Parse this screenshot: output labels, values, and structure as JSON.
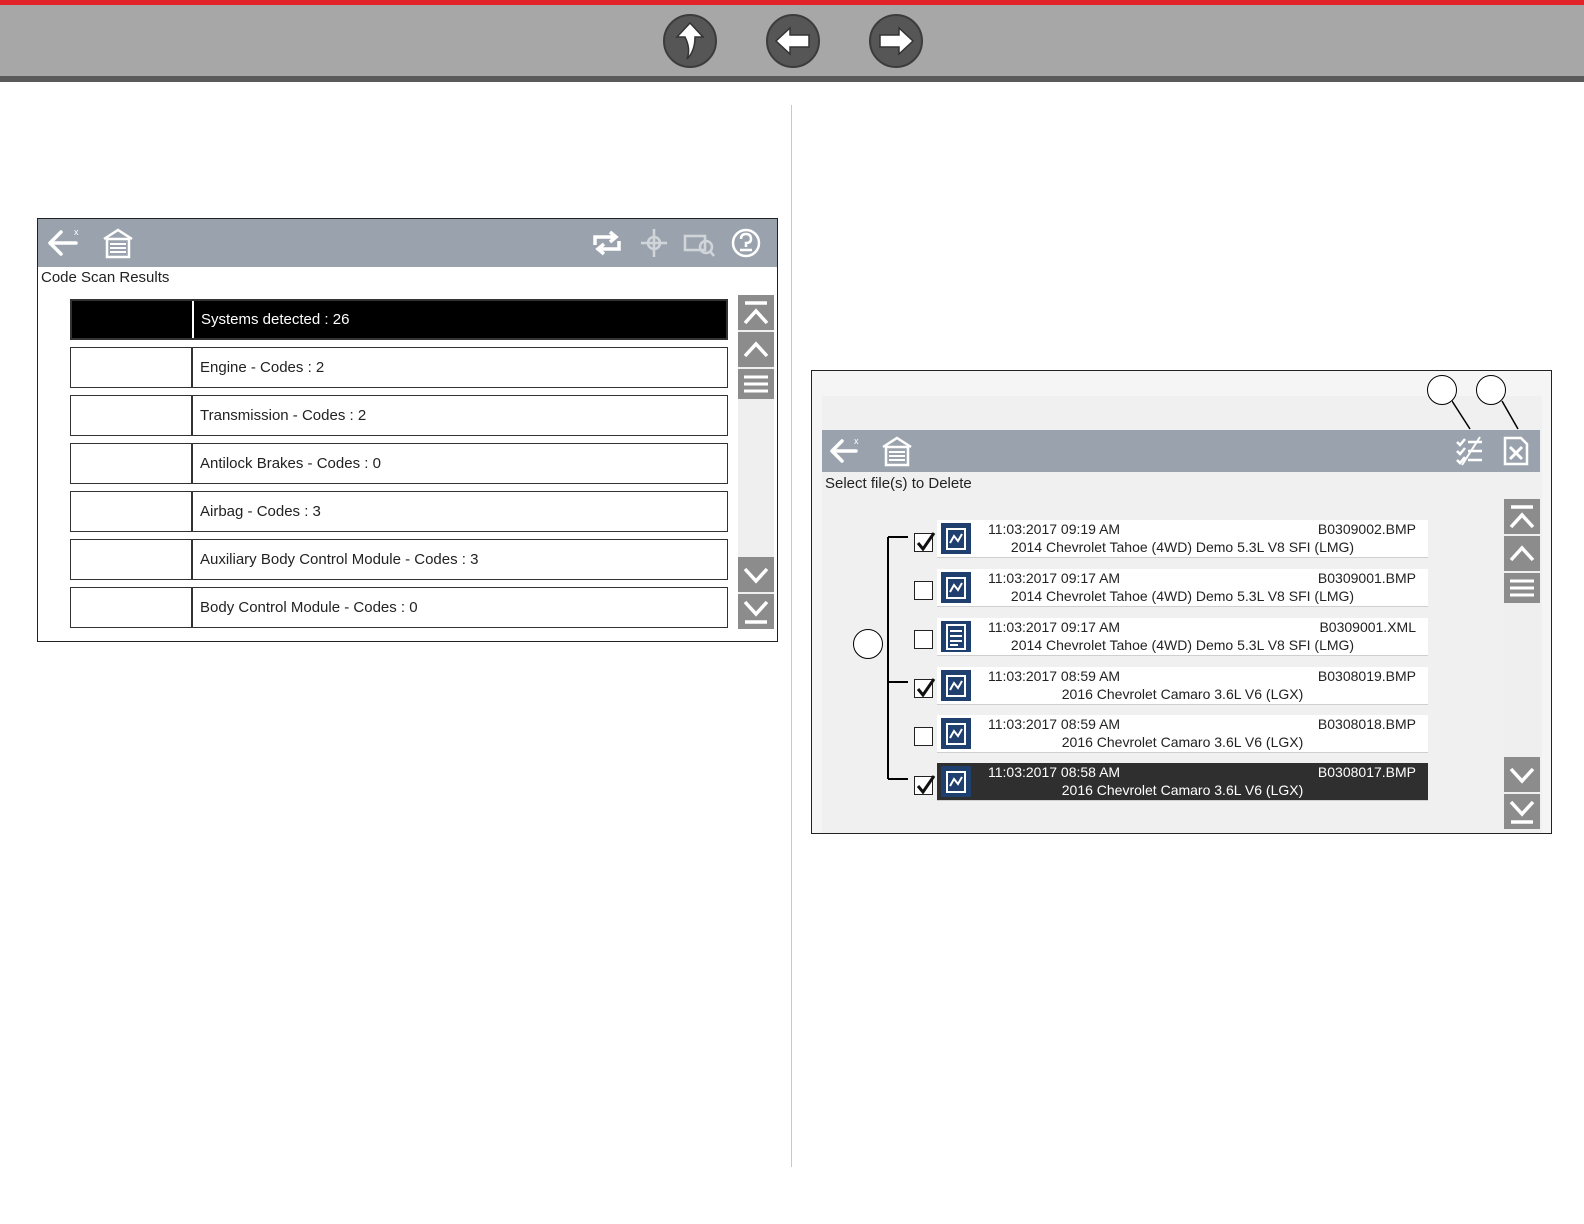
{
  "topnav": {
    "buttons": [
      {
        "name": "up-arrow-icon"
      },
      {
        "name": "back-arrow-icon"
      },
      {
        "name": "forward-arrow-icon"
      }
    ]
  },
  "screen1": {
    "title": "Code Scan Results",
    "toolbar_icons": [
      "back-icon",
      "home-icon",
      "refresh-icon",
      "vehicle-system-icon",
      "engine-search-icon",
      "help-icon"
    ],
    "rows": [
      {
        "label": "Systems detected : 26",
        "selected": true
      },
      {
        "label": "Engine - Codes : 2",
        "selected": false
      },
      {
        "label": "Transmission - Codes : 2",
        "selected": false
      },
      {
        "label": "Antilock Brakes - Codes : 0",
        "selected": false
      },
      {
        "label": "Airbag - Codes : 3",
        "selected": false
      },
      {
        "label": "Auxiliary Body Control Module - Codes : 3",
        "selected": false
      },
      {
        "label": "Body Control Module - Codes : 0",
        "selected": false
      }
    ]
  },
  "screen2": {
    "title": "Select file(s) to Delete",
    "toolbar_icons": [
      "back-icon",
      "home-icon",
      "select-all-icon",
      "delete-icon"
    ],
    "files": [
      {
        "date": "11:03:2017 09:19 AM",
        "file": "B0309002.BMP",
        "vehicle": "2014 Chevrolet Tahoe (4WD) Demo 5.3L V8 SFI (LMG)",
        "checked": true,
        "type": "image",
        "highlighted": false
      },
      {
        "date": "11:03:2017 09:17 AM",
        "file": "B0309001.BMP",
        "vehicle": "2014 Chevrolet Tahoe (4WD) Demo 5.3L V8 SFI (LMG)",
        "checked": false,
        "type": "image",
        "highlighted": false
      },
      {
        "date": "11:03:2017 09:17 AM",
        "file": "B0309001.XML",
        "vehicle": "2014 Chevrolet Tahoe (4WD) Demo 5.3L V8 SFI (LMG)",
        "checked": false,
        "type": "data",
        "highlighted": false
      },
      {
        "date": "11:03:2017 08:59 AM",
        "file": "B0308019.BMP",
        "vehicle": "2016 Chevrolet Camaro 3.6L V6 (LGX)",
        "checked": true,
        "type": "image",
        "highlighted": false
      },
      {
        "date": "11:03:2017 08:59 AM",
        "file": "B0308018.BMP",
        "vehicle": "2016 Chevrolet Camaro 3.6L V6 (LGX)",
        "checked": false,
        "type": "image",
        "highlighted": false
      },
      {
        "date": "11:03:2017 08:58 AM",
        "file": "B0308017.BMP",
        "vehicle": "2016 Chevrolet Camaro 3.6L V6 (LGX)",
        "checked": true,
        "type": "image",
        "highlighted": true
      }
    ]
  },
  "colors": {
    "top_accent": "#e2232a",
    "toolbar": "#9aa3ad",
    "selected_row": "#000000",
    "file_icon": "#1f3f6f"
  }
}
